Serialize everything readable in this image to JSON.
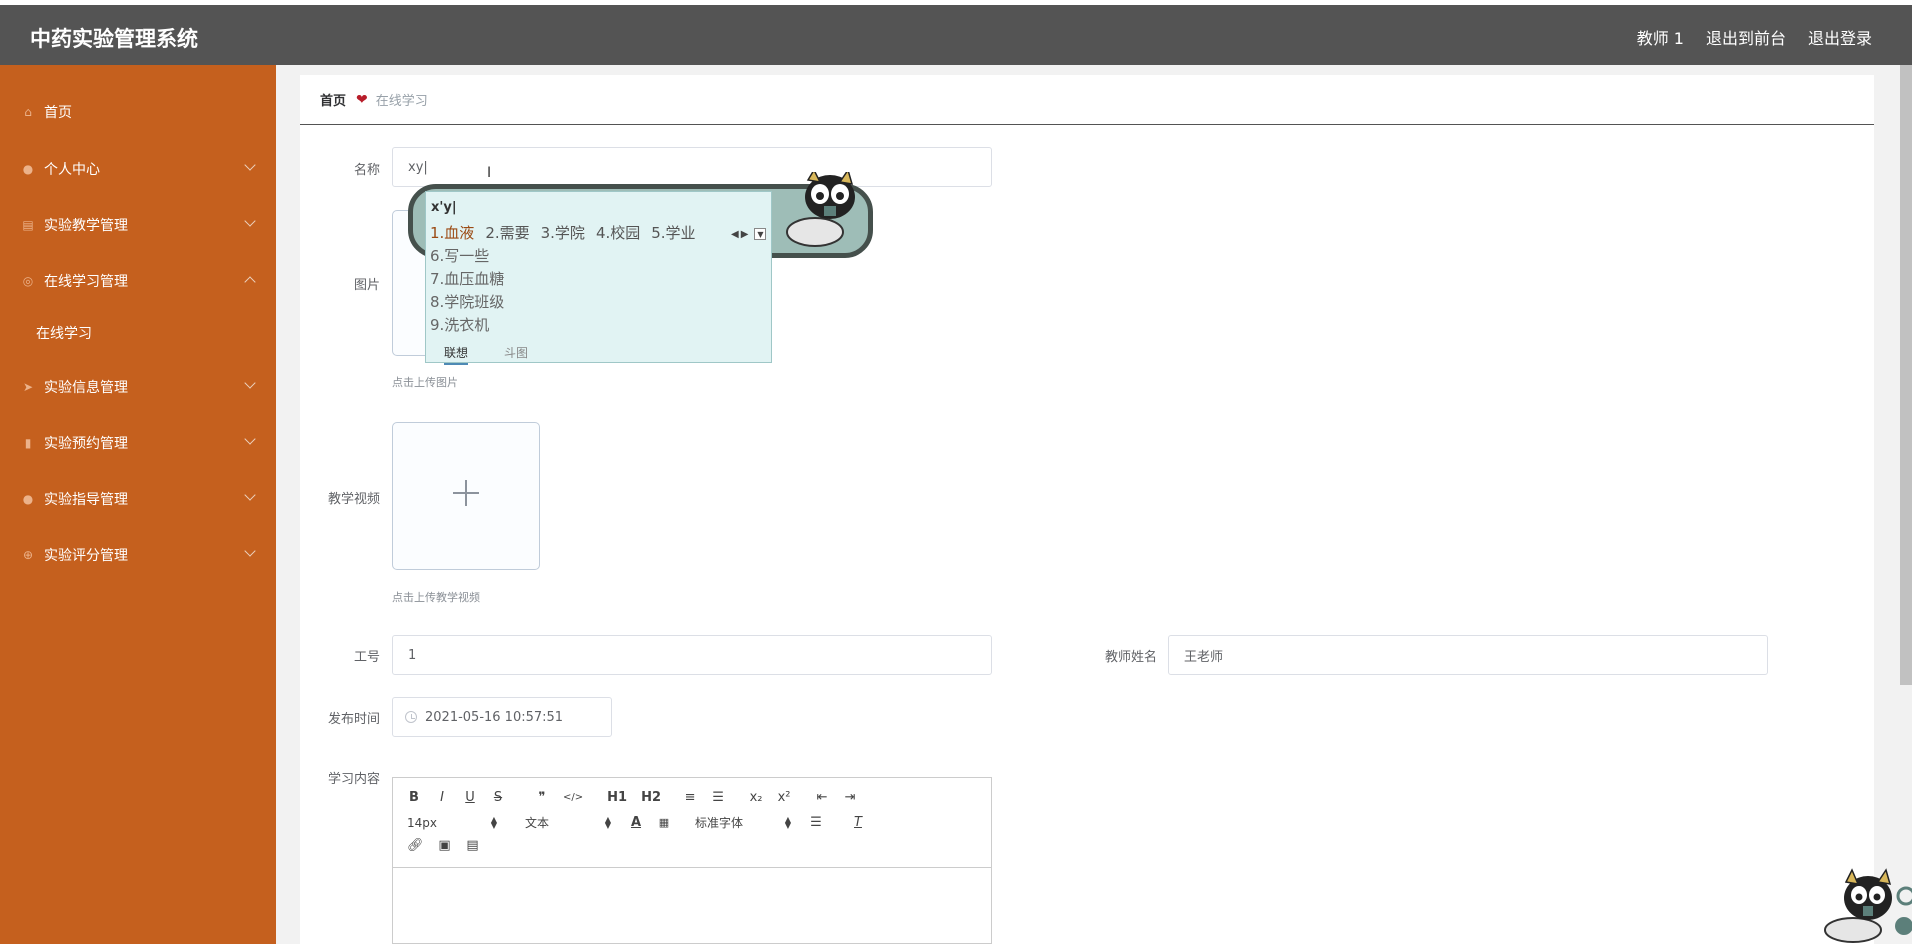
{
  "app": {
    "title": "中药实验管理系统"
  },
  "topnav": {
    "user": "教师 1",
    "to_front": "退出到前台",
    "logout": "退出登录"
  },
  "sidebar": {
    "items": [
      {
        "label": "首页",
        "icon": "home-icon",
        "has_children": false
      },
      {
        "label": "个人中心",
        "icon": "user-icon",
        "has_children": true
      },
      {
        "label": "实验教学管理",
        "icon": "clipboard-icon",
        "has_children": true
      },
      {
        "label": "在线学习管理",
        "icon": "globe-icon",
        "has_children": true,
        "expanded": true
      },
      {
        "label": "实验信息管理",
        "icon": "send-icon",
        "has_children": true
      },
      {
        "label": "实验预约管理",
        "icon": "chart-icon",
        "has_children": true
      },
      {
        "label": "实验指导管理",
        "icon": "user-icon",
        "has_children": true
      },
      {
        "label": "实验评分管理",
        "icon": "target-icon",
        "has_children": true
      }
    ],
    "subitems": [
      {
        "label": "在线学习",
        "parent": "在线学习管理"
      }
    ]
  },
  "breadcrumb": {
    "home": "首页",
    "current": "在线学习"
  },
  "form": {
    "name": {
      "label": "名称",
      "value": "xy|"
    },
    "image": {
      "label": "图片",
      "hint": "点击上传图片"
    },
    "video": {
      "label": "教学视频",
      "hint": "点击上传教学视频"
    },
    "job_no": {
      "label": "工号",
      "value": "1"
    },
    "teacher_name": {
      "label": "教师姓名",
      "value": "王老师"
    },
    "publish_time": {
      "label": "发布时间",
      "value": "2021-05-16 10:57:51"
    },
    "content": {
      "label": "学习内容"
    }
  },
  "editor": {
    "row1": [
      "B",
      "I",
      "U",
      "S",
      "❞",
      "</>",
      "H1",
      "H2",
      "≡",
      "☰",
      "x₂",
      "x²",
      "⇤",
      "⇥"
    ],
    "font_size": "14px",
    "block_type": "文本",
    "font_family": "标准字体",
    "row3_icons": [
      "link-icon",
      "image-icon",
      "video-icon"
    ]
  },
  "ime": {
    "pinyin": "x'y|",
    "candidates_row": [
      "1.血液",
      "2.需要",
      "3.学院",
      "4.校园",
      "5.学业"
    ],
    "candidates_list": [
      "6.写一些",
      "7.血压血糖",
      "8.学院班级",
      "9.洗衣机"
    ],
    "tabs": [
      "联想",
      "斗图"
    ]
  },
  "colors": {
    "topbar": "#545454",
    "sidebar": "#c5601e",
    "heart": "#b81d2a",
    "ime_bg": "#e1f3f3"
  }
}
